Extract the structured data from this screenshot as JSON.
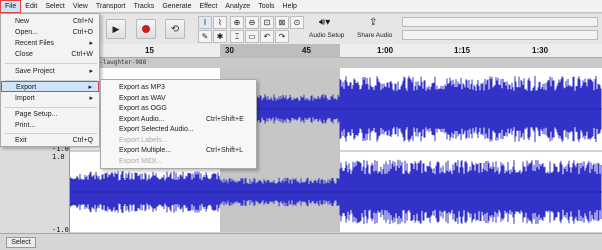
{
  "menubar": {
    "items": [
      "File",
      "Edit",
      "Select",
      "View",
      "Transport",
      "Tracks",
      "Generate",
      "Effect",
      "Analyze",
      "Tools",
      "Help"
    ]
  },
  "toolbar": {
    "audio_setup_label": "Audio Setup",
    "share_audio_label": "Share Audio"
  },
  "timeline": {
    "ticks": [
      "15",
      "30",
      "45",
      "1:00",
      "1:15",
      "1:30"
    ]
  },
  "track": {
    "clip_name": "and-his-laughter-988",
    "scale_top_1": "1.0",
    "scale_top_2": "1.0",
    "scale_bottom": "-1.0",
    "scale_bottom_2": "-1.0",
    "select_label": "Select"
  },
  "file_menu": {
    "items": [
      {
        "label": "New",
        "shortcut": "Ctrl+N"
      },
      {
        "label": "Open...",
        "shortcut": "Ctrl+O"
      },
      {
        "label": "Recent Files",
        "shortcut": "▸"
      },
      {
        "label": "Close",
        "shortcut": "Ctrl+W"
      },
      {
        "label": "Save Project",
        "shortcut": "▸"
      },
      {
        "label": "Export",
        "shortcut": "▸"
      },
      {
        "label": "Import",
        "shortcut": "▸"
      },
      {
        "label": "Page Setup...",
        "shortcut": ""
      },
      {
        "label": "Print...",
        "shortcut": ""
      },
      {
        "label": "Exit",
        "shortcut": "Ctrl+Q"
      }
    ]
  },
  "export_menu": {
    "items": [
      {
        "label": "Export as MP3",
        "shortcut": "",
        "disabled": false
      },
      {
        "label": "Export as WAV",
        "shortcut": "",
        "disabled": false
      },
      {
        "label": "Export as OGG",
        "shortcut": "",
        "disabled": false
      },
      {
        "label": "Export Audio...",
        "shortcut": "Ctrl+Shift+E",
        "disabled": false
      },
      {
        "label": "Export Selected Audio...",
        "shortcut": "",
        "disabled": false
      },
      {
        "label": "Export Labels...",
        "shortcut": "",
        "disabled": true
      },
      {
        "label": "Export Multiple...",
        "shortcut": "Ctrl+Shift+L",
        "disabled": false
      },
      {
        "label": "Export MIDI...",
        "shortcut": "",
        "disabled": true
      }
    ]
  },
  "colors": {
    "waveform": "#3232c8",
    "selection": "#b9b9b9",
    "menu_highlight": "#cfe3f7",
    "highlight_border": "#dd4444"
  },
  "icons": [
    "play-icon",
    "record-icon",
    "loop-icon",
    "selection-tool-icon",
    "envelope-tool-icon",
    "draw-tool-icon",
    "multi-tool-icon",
    "zoom-in-icon",
    "zoom-out-icon",
    "fit-selection-icon",
    "fit-project-icon",
    "zoom-toggle-icon",
    "trim-icon",
    "silence-icon",
    "undo-icon",
    "redo-icon",
    "speaker-icon",
    "share-icon"
  ]
}
